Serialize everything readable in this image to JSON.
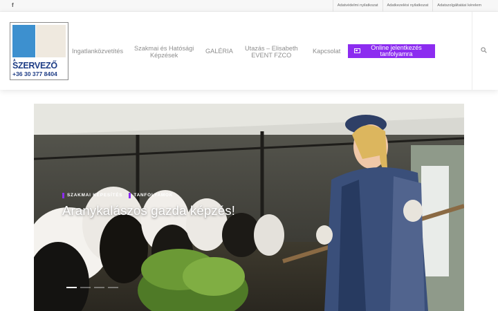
{
  "topbar": {
    "social_icon": "f",
    "links": [
      "Adatvédelmi nyilatkozat",
      "Adatkezelési nyilatkozat",
      "Adatszolgáltatási kérelem"
    ]
  },
  "logo": {
    "small_text": "A",
    "brand": "SZERVEZŐ",
    "phone": "+36 30 377 8404"
  },
  "nav": {
    "items": [
      "Ingatlanközvetítés",
      "Szakmai és Hatósági\nKépzések",
      "GALÉRIA",
      "Utazás – Elisabeth\nEVENT FZCO",
      "Kapcsolat"
    ],
    "cta": "Online jelentkezés\ntanfolyamra",
    "search_icon": "search-icon"
  },
  "hero": {
    "categories": [
      "SZAKMAI KÉPESÍTÉS",
      "TANFOLYAMOK"
    ],
    "headline": "Aranykalászos gazda képzés!",
    "slides_count": 4,
    "active_slide": 1
  },
  "colors": {
    "accent": "#8c2cf0",
    "logo_blue": "#3d90cf",
    "logo_text": "#1d3c85",
    "nav_text": "#8d8d8d"
  }
}
